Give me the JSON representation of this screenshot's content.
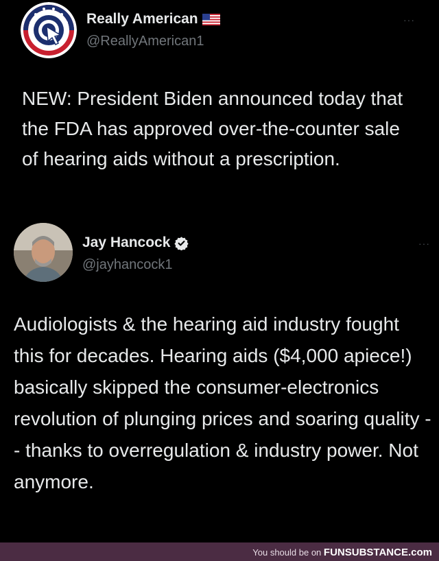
{
  "tweet1": {
    "name": "Really American",
    "flag": "🇺🇸",
    "handle": "@ReallyAmerican1",
    "more": "···",
    "text": "NEW: President Biden announced today that the FDA has approved over-the-counter sale of hearing aids without a prescription."
  },
  "tweet2": {
    "name": "Jay Hancock",
    "handle": "@jayhancock1",
    "more": "···",
    "text": "Audiologists & the hearing aid industry fought this for decades. Hearing aids ($4,000 apiece!) basically skipped the consumer-electronics revolution of plunging prices and soaring quality -- thanks to overregulation & industry power. Not anymore."
  },
  "footer": {
    "prefix": "You should be on",
    "brand": "FUNSUBSTANCE.com"
  },
  "colors": {
    "background": "#000000",
    "text": "#e7e9ea",
    "muted": "#71767b",
    "verified": "#e7e9ea",
    "footer": "#4b2c43"
  }
}
